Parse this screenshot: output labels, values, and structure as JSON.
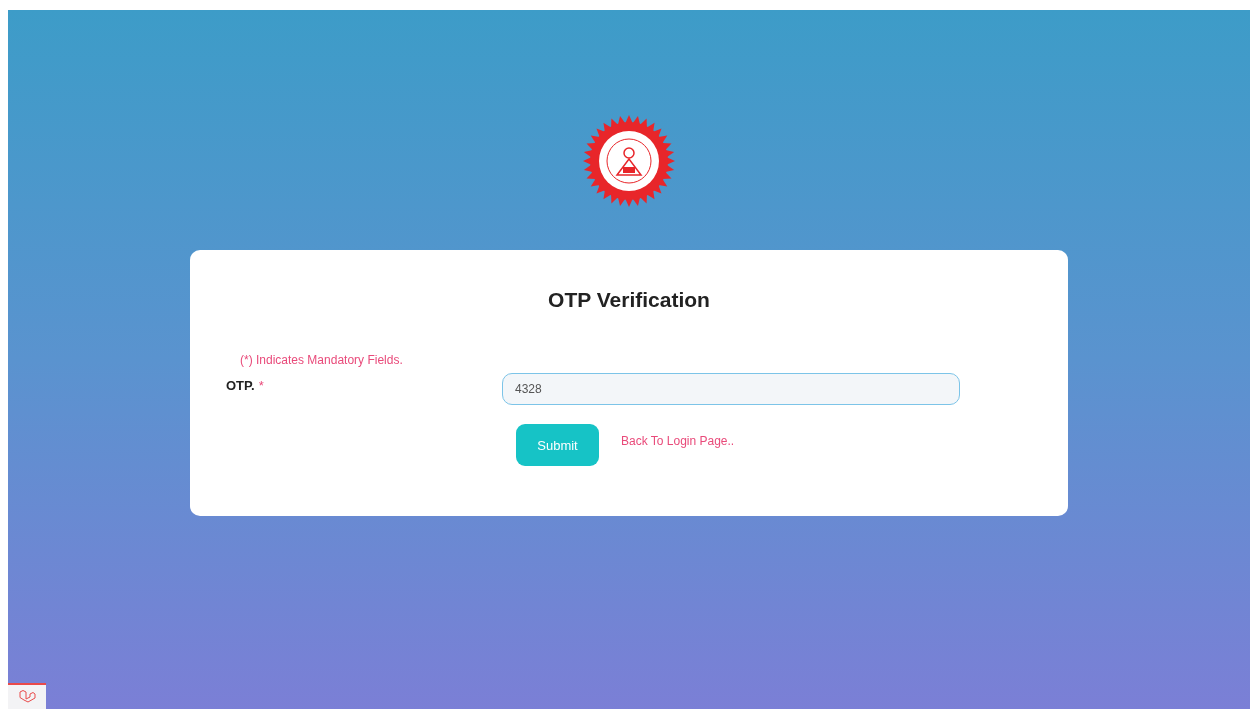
{
  "card": {
    "title": "OTP Verification",
    "mandatory_note": "(*) Indicates Mandatory Fields.",
    "otp_field": {
      "label": "OTP.",
      "required_mark": "*",
      "value": "4328"
    },
    "submit_button": "Submit",
    "back_link": "Back To Login Page.."
  }
}
